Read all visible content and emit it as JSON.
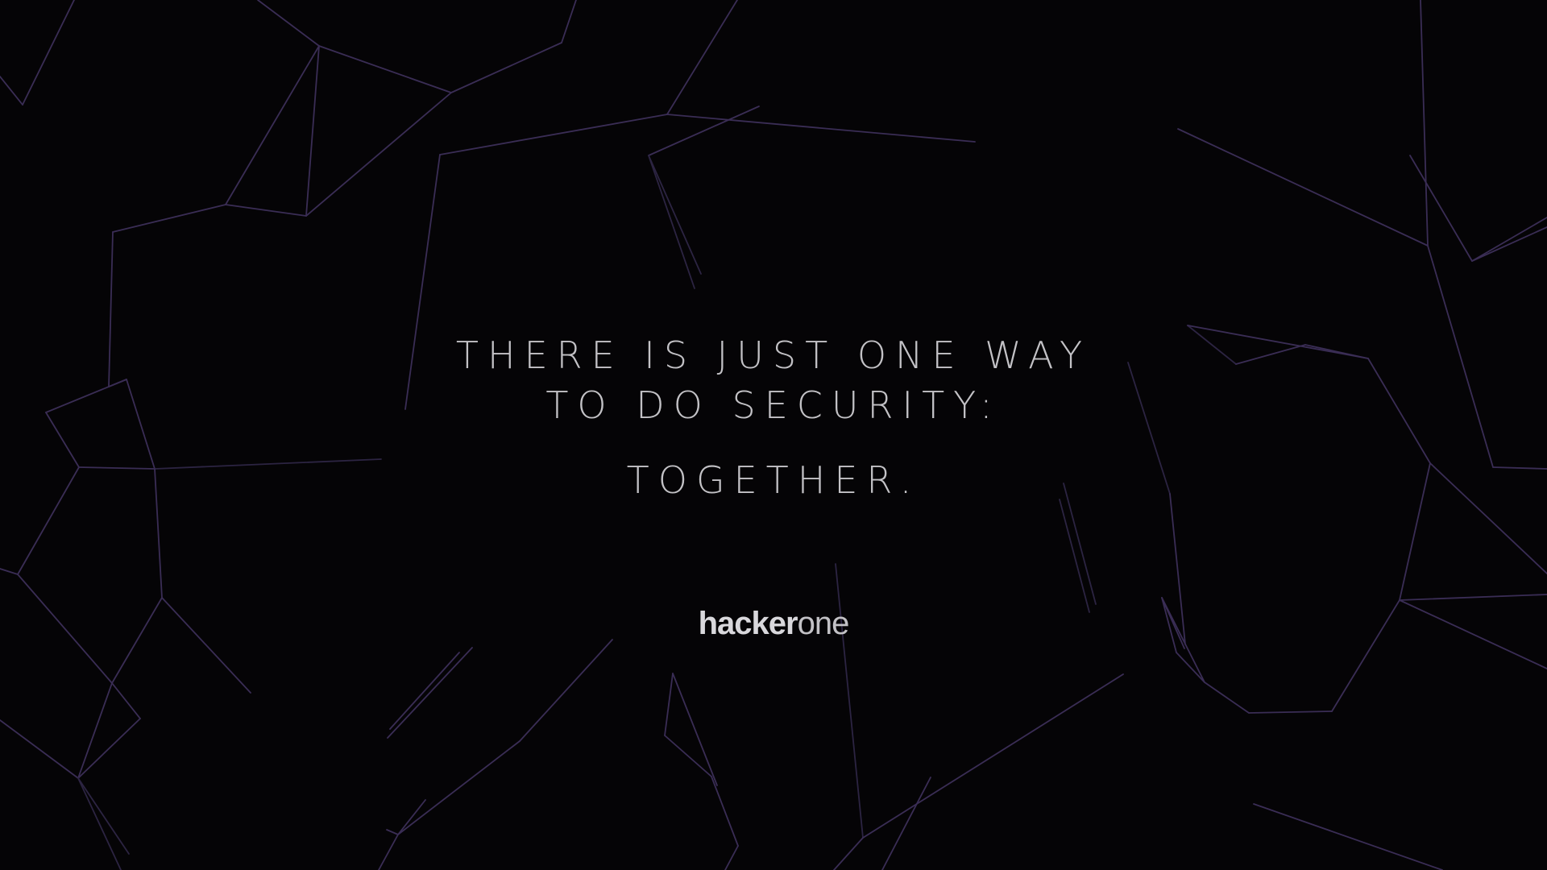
{
  "message": {
    "line1": "THERE IS JUST ONE WAY",
    "line2": "TO DO SECURITY:",
    "line3": "TOGETHER."
  },
  "logo": {
    "part1": "hacker",
    "part2": "one"
  },
  "colors": {
    "background": "#050406",
    "line_primary": "#3a2d55",
    "line_secondary": "#2c2442",
    "text": "#c3c2c6"
  },
  "decoration": "network-lines"
}
